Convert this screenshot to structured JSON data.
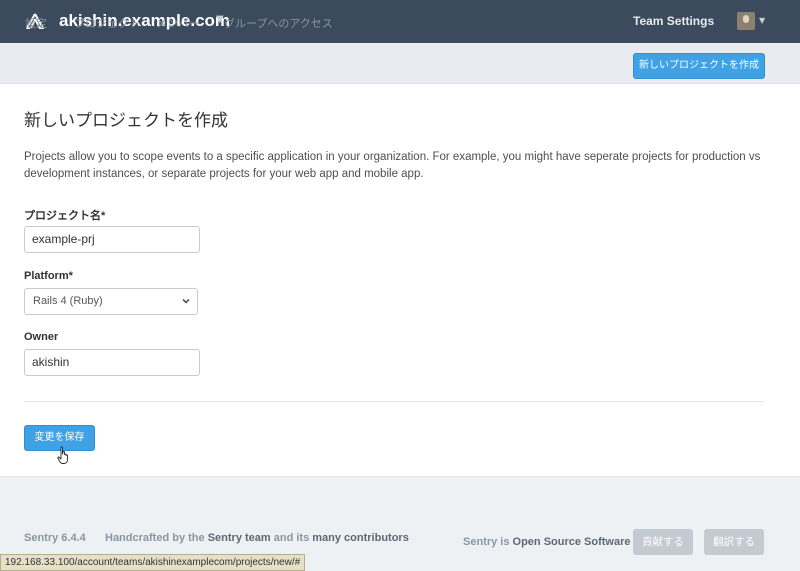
{
  "header": {
    "org_name": "akishin.example.com",
    "team_settings": "Team Settings"
  },
  "subnav": {
    "items": [
      "設定",
      "プロジェクト",
      "メンバー",
      "グループへのアクセス"
    ],
    "new_project_button": "新しいプロジェクトを作成"
  },
  "page": {
    "title": "新しいプロジェクトを作成",
    "intro_line1": "Projects allow you to scope events to a specific application in your organization. For example, you might have seperate projects for production vs",
    "intro_line2": "development instances, or separate projects for your web app and mobile app."
  },
  "form": {
    "project_name": {
      "label": "プロジェクト名*",
      "value": "example-prj"
    },
    "platform": {
      "label": "Platform*",
      "value": "Rails 4 (Ruby)"
    },
    "owner": {
      "label": "Owner",
      "value": "akishin"
    },
    "save_button": "変更を保存"
  },
  "footer": {
    "version": "Sentry 6.4.4",
    "handcrafted_prefix": "Handcrafted by the",
    "sentry_team": "Sentry team",
    "and_its": "and its",
    "many_contributors": "many contributors",
    "sentry_is": "Sentry is",
    "open_source": "Open Source Software",
    "contribute_button": "貢献する",
    "translate_button": "翻訳する"
  },
  "status_bar": {
    "url": "192.168.33.100/account/teams/akishinexamplecom/projects/new/#"
  },
  "colors": {
    "topbar": "#3c4a5d",
    "accent": "#40a2e5",
    "subnav_bg": "#e8ebf0",
    "footer_bg": "#eef1f4"
  }
}
